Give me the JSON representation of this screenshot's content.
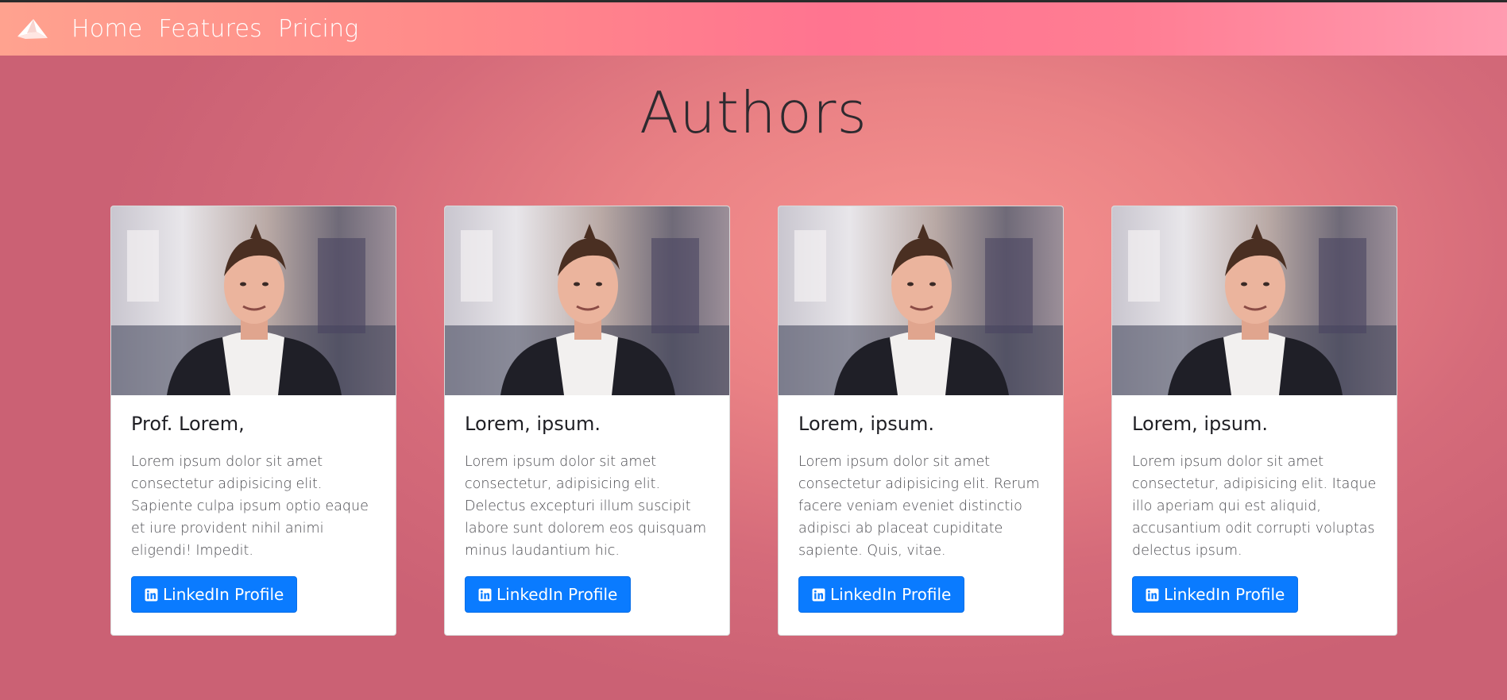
{
  "navbar": {
    "logo_icon": "paper-plane-logo-icon",
    "links": [
      "Home",
      "Features",
      "Pricing"
    ]
  },
  "page": {
    "title": "Authors"
  },
  "cards": [
    {
      "name": "Prof. Lorem,",
      "bio": "Lorem ipsum dolor sit amet consectetur adipisicing elit. Sapiente culpa ipsum optio eaque et iure provident nihil animi eligendi! Impedit.",
      "button_label": "LinkedIn Profile",
      "button_icon": "linkedin-icon"
    },
    {
      "name": "Lorem, ipsum.",
      "bio": "Lorem ipsum dolor sit amet consectetur, adipisicing elit. Delectus excepturi illum suscipit labore sunt dolorem eos quisquam minus laudantium hic.",
      "button_label": "LinkedIn Profile",
      "button_icon": "linkedin-icon"
    },
    {
      "name": "Lorem, ipsum.",
      "bio": "Lorem ipsum dolor sit amet consectetur adipisicing elit. Rerum facere veniam eveniet distinctio adipisci ab placeat cupiditate sapiente. Quis, vitae.",
      "button_label": "LinkedIn Profile",
      "button_icon": "linkedin-icon"
    },
    {
      "name": "Lorem, ipsum.",
      "bio": "Lorem ipsum dolor sit amet consectetur, adipisicing elit. Itaque illo aperiam qui est aliquid, accusantium odit corrupti voluptas delectus ipsum.",
      "button_label": "LinkedIn Profile",
      "button_icon": "linkedin-icon"
    }
  ],
  "colors": {
    "button": "#0a7bff",
    "title_text": "#2e2a2f"
  }
}
